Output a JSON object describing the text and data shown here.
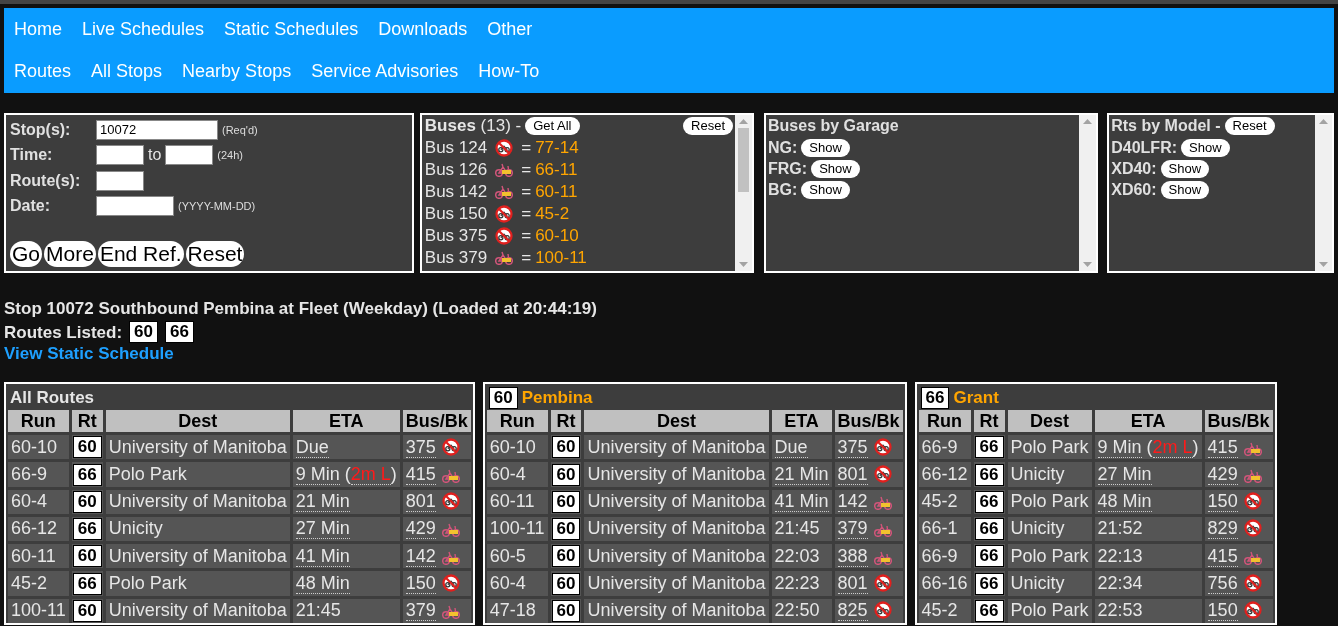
{
  "nav": {
    "rows": [
      [
        "Home",
        "Live Schedules",
        "Static Schedules",
        "Downloads",
        "Other"
      ],
      [
        "Routes",
        "All Stops",
        "Nearby Stops",
        "Service Advisories",
        "How-To"
      ]
    ]
  },
  "query": {
    "fields": [
      {
        "kind": "stop",
        "label": "Stop(s):",
        "value": "10072",
        "hint": "(Req'd)"
      },
      {
        "kind": "range",
        "label": "Time:",
        "joiner": "to",
        "hint": "(24h)"
      },
      {
        "kind": "route",
        "label": "Route(s):"
      },
      {
        "kind": "date",
        "label": "Date:",
        "hint": "(YYYY-MM-DD)"
      }
    ],
    "buttons": [
      "Go",
      "More",
      "End Ref.",
      "Reset"
    ]
  },
  "buses_panel": {
    "title": "Buses",
    "count": "(13)",
    "dash": "-",
    "get_all": "Get All",
    "reset": "Reset",
    "items": [
      {
        "bus": "Bus 124",
        "bike_rack": false,
        "eq": "=",
        "run": "77-14"
      },
      {
        "bus": "Bus 126",
        "bike_rack": true,
        "eq": "=",
        "run": "66-11"
      },
      {
        "bus": "Bus 142",
        "bike_rack": true,
        "eq": "=",
        "run": "60-11"
      },
      {
        "bus": "Bus 150",
        "bike_rack": false,
        "eq": "=",
        "run": "45-2"
      },
      {
        "bus": "Bus 375",
        "bike_rack": false,
        "eq": "=",
        "run": "60-10"
      },
      {
        "bus": "Bus 379",
        "bike_rack": true,
        "eq": "=",
        "run": "100-11"
      }
    ]
  },
  "garage_panel": {
    "title": "Buses by Garage",
    "items": [
      {
        "label": "NG:",
        "button": "Show"
      },
      {
        "label": "FRG:",
        "button": "Show"
      },
      {
        "label": "BG:",
        "button": "Show"
      }
    ]
  },
  "model_panel": {
    "title": "Rts by Model -",
    "reset": "Reset",
    "items": [
      {
        "label": "D40LFR:",
        "button": "Show"
      },
      {
        "label": "XD40:",
        "button": "Show"
      },
      {
        "label": "XD60:",
        "button": "Show"
      }
    ]
  },
  "stop_info": {
    "title": "Stop 10072 Southbound Pembina at Fleet (Weekday) (Loaded at 20:44:19)",
    "routes_label": "Routes Listed:",
    "routes": [
      "60",
      "66"
    ],
    "link": "View Static Schedule"
  },
  "tables": [
    {
      "title": "All Routes",
      "columns": [
        "Run",
        "Rt",
        "Dest",
        "ETA",
        "Bus/Bk"
      ],
      "rows": [
        {
          "run": "60-10",
          "rt": "60",
          "dest": "University of Manitoba",
          "eta": "Due",
          "live": true,
          "bus": "375",
          "bike_rack": false
        },
        {
          "run": "66-9",
          "rt": "66",
          "dest": "Polo Park",
          "eta": "9 Min",
          "live": true,
          "late": {
            "open": "(",
            "text": "2m L",
            "close": ")"
          },
          "bus": "415",
          "bike_rack": true
        },
        {
          "run": "60-4",
          "rt": "60",
          "dest": "University of Manitoba",
          "eta": "21 Min",
          "live": true,
          "bus": "801",
          "bike_rack": false
        },
        {
          "run": "66-12",
          "rt": "66",
          "dest": "Unicity",
          "eta": "27 Min",
          "live": true,
          "bus": "429",
          "bike_rack": true
        },
        {
          "run": "60-11",
          "rt": "60",
          "dest": "University of Manitoba",
          "eta": "41 Min",
          "live": true,
          "bus": "142",
          "bike_rack": true
        },
        {
          "run": "45-2",
          "rt": "66",
          "dest": "Polo Park",
          "eta": "48 Min",
          "live": true,
          "bus": "150",
          "bike_rack": false
        },
        {
          "run": "100-11",
          "rt": "60",
          "dest": "University of Manitoba",
          "eta": "21:45",
          "live": false,
          "bus": "379",
          "bike_rack": true
        }
      ]
    },
    {
      "route": "60",
      "name": "Pembina",
      "columns": [
        "Run",
        "Rt",
        "Dest",
        "ETA",
        "Bus/Bk"
      ],
      "rows": [
        {
          "run": "60-10",
          "rt": "60",
          "dest": "University of Manitoba",
          "eta": "Due",
          "live": true,
          "bus": "375",
          "bike_rack": false
        },
        {
          "run": "60-4",
          "rt": "60",
          "dest": "University of Manitoba",
          "eta": "21 Min",
          "live": true,
          "bus": "801",
          "bike_rack": false
        },
        {
          "run": "60-11",
          "rt": "60",
          "dest": "University of Manitoba",
          "eta": "41 Min",
          "live": true,
          "bus": "142",
          "bike_rack": true
        },
        {
          "run": "100-11",
          "rt": "60",
          "dest": "University of Manitoba",
          "eta": "21:45",
          "live": false,
          "bus": "379",
          "bike_rack": true
        },
        {
          "run": "60-5",
          "rt": "60",
          "dest": "University of Manitoba",
          "eta": "22:03",
          "live": false,
          "bus": "388",
          "bike_rack": true
        },
        {
          "run": "60-4",
          "rt": "60",
          "dest": "University of Manitoba",
          "eta": "22:23",
          "live": false,
          "bus": "801",
          "bike_rack": false
        },
        {
          "run": "47-18",
          "rt": "60",
          "dest": "University of Manitoba",
          "eta": "22:50",
          "live": false,
          "bus": "825",
          "bike_rack": false
        }
      ]
    },
    {
      "route": "66",
      "name": "Grant",
      "columns": [
        "Run",
        "Rt",
        "Dest",
        "ETA",
        "Bus/Bk"
      ],
      "rows": [
        {
          "run": "66-9",
          "rt": "66",
          "dest": "Polo Park",
          "eta": "9 Min",
          "live": true,
          "late": {
            "open": "(",
            "text": "2m L",
            "close": ")"
          },
          "bus": "415",
          "bike_rack": true
        },
        {
          "run": "66-12",
          "rt": "66",
          "dest": "Unicity",
          "eta": "27 Min",
          "live": true,
          "bus": "429",
          "bike_rack": true
        },
        {
          "run": "45-2",
          "rt": "66",
          "dest": "Polo Park",
          "eta": "48 Min",
          "live": true,
          "bus": "150",
          "bike_rack": false
        },
        {
          "run": "66-1",
          "rt": "66",
          "dest": "Unicity",
          "eta": "21:52",
          "live": false,
          "bus": "829",
          "bike_rack": false
        },
        {
          "run": "66-9",
          "rt": "66",
          "dest": "Polo Park",
          "eta": "22:13",
          "live": false,
          "bus": "415",
          "bike_rack": true
        },
        {
          "run": "66-16",
          "rt": "66",
          "dest": "Unicity",
          "eta": "22:34",
          "live": false,
          "bus": "756",
          "bike_rack": false
        },
        {
          "run": "45-2",
          "rt": "66",
          "dest": "Polo Park",
          "eta": "22:53",
          "live": false,
          "bus": "150",
          "bike_rack": false
        }
      ]
    }
  ]
}
